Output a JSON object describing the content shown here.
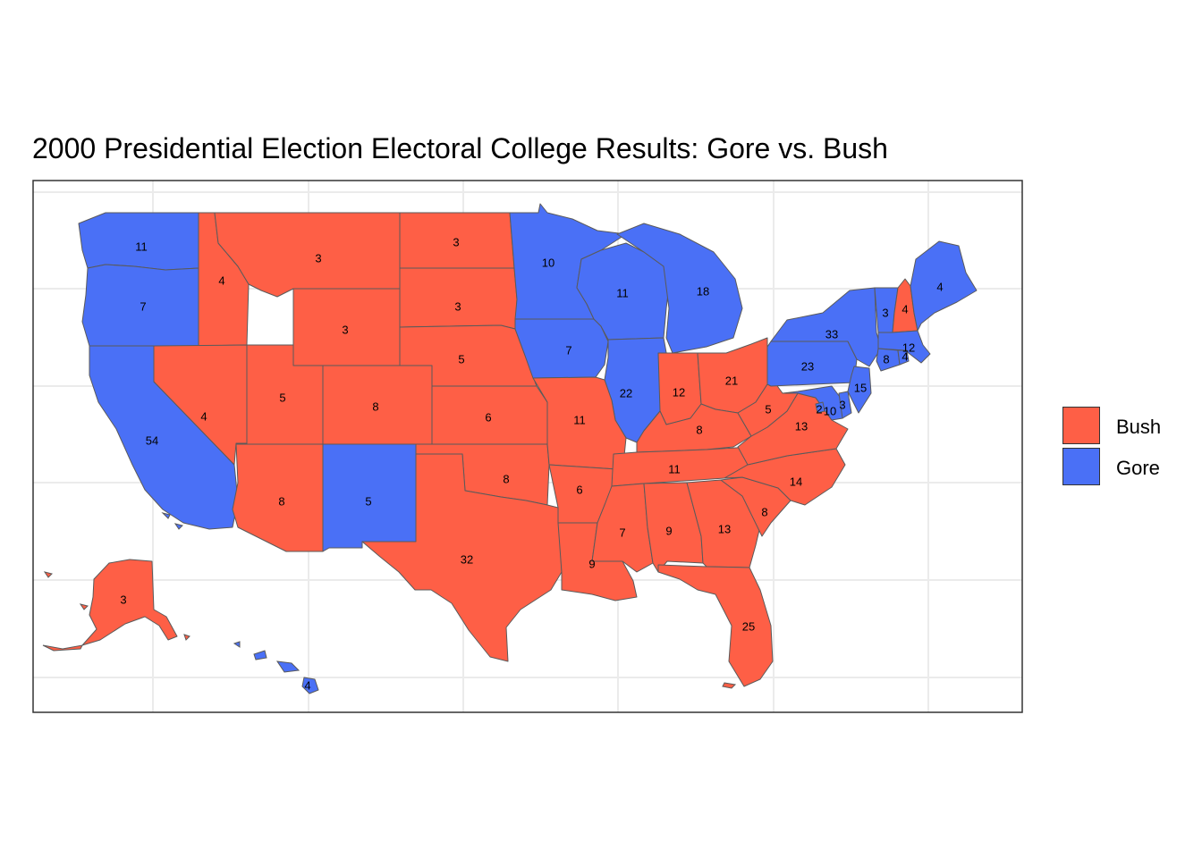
{
  "title": "2000 Presidential Election Electoral College Results: Gore vs. Bush",
  "colors": {
    "Bush": "#fe5f46",
    "Gore": "#4a70f6",
    "border": "#5a5a5a",
    "grid": "#ebebeb",
    "panel_border": "#333333"
  },
  "legend": {
    "items": [
      {
        "label": "Bush",
        "color": "#fe5f46"
      },
      {
        "label": "Gore",
        "color": "#4a70f6"
      }
    ]
  },
  "chart_data": {
    "type": "choropleth",
    "title": "2000 Presidential Election Electoral College Results: Gore vs. Bush",
    "legend_position": "right",
    "categories": [
      "Bush",
      "Gore"
    ],
    "states": [
      {
        "state": "WA",
        "votes": 11,
        "winner": "Gore"
      },
      {
        "state": "OR",
        "votes": 7,
        "winner": "Gore"
      },
      {
        "state": "CA",
        "votes": 54,
        "winner": "Gore"
      },
      {
        "state": "ID",
        "votes": 4,
        "winner": "Bush"
      },
      {
        "state": "NV",
        "votes": 4,
        "winner": "Bush"
      },
      {
        "state": "MT",
        "votes": 3,
        "winner": "Bush"
      },
      {
        "state": "WY",
        "votes": 3,
        "winner": "Bush"
      },
      {
        "state": "UT",
        "votes": 5,
        "winner": "Bush"
      },
      {
        "state": "AZ",
        "votes": 8,
        "winner": "Bush"
      },
      {
        "state": "CO",
        "votes": 8,
        "winner": "Bush"
      },
      {
        "state": "NM",
        "votes": 5,
        "winner": "Gore"
      },
      {
        "state": "ND",
        "votes": 3,
        "winner": "Bush"
      },
      {
        "state": "SD",
        "votes": 3,
        "winner": "Bush"
      },
      {
        "state": "NE",
        "votes": 5,
        "winner": "Bush"
      },
      {
        "state": "KS",
        "votes": 6,
        "winner": "Bush"
      },
      {
        "state": "OK",
        "votes": 8,
        "winner": "Bush"
      },
      {
        "state": "TX",
        "votes": 32,
        "winner": "Bush"
      },
      {
        "state": "MN",
        "votes": 10,
        "winner": "Gore"
      },
      {
        "state": "IA",
        "votes": 7,
        "winner": "Gore"
      },
      {
        "state": "MO",
        "votes": 11,
        "winner": "Bush"
      },
      {
        "state": "AR",
        "votes": 6,
        "winner": "Bush"
      },
      {
        "state": "LA",
        "votes": 9,
        "winner": "Bush"
      },
      {
        "state": "WI",
        "votes": 11,
        "winner": "Gore"
      },
      {
        "state": "IL",
        "votes": 22,
        "winner": "Gore"
      },
      {
        "state": "MI",
        "votes": 18,
        "winner": "Gore"
      },
      {
        "state": "IN",
        "votes": 12,
        "winner": "Bush"
      },
      {
        "state": "OH",
        "votes": 21,
        "winner": "Bush"
      },
      {
        "state": "KY",
        "votes": 8,
        "winner": "Bush"
      },
      {
        "state": "TN",
        "votes": 11,
        "winner": "Bush"
      },
      {
        "state": "MS",
        "votes": 7,
        "winner": "Bush"
      },
      {
        "state": "AL",
        "votes": 9,
        "winner": "Bush"
      },
      {
        "state": "GA",
        "votes": 13,
        "winner": "Bush"
      },
      {
        "state": "FL",
        "votes": 25,
        "winner": "Bush"
      },
      {
        "state": "SC",
        "votes": 8,
        "winner": "Bush"
      },
      {
        "state": "NC",
        "votes": 14,
        "winner": "Bush"
      },
      {
        "state": "VA",
        "votes": 13,
        "winner": "Bush"
      },
      {
        "state": "WV",
        "votes": 5,
        "winner": "Bush"
      },
      {
        "state": "PA",
        "votes": 23,
        "winner": "Gore"
      },
      {
        "state": "NY",
        "votes": 33,
        "winner": "Gore"
      },
      {
        "state": "VT",
        "votes": 3,
        "winner": "Gore"
      },
      {
        "state": "NH",
        "votes": 4,
        "winner": "Bush"
      },
      {
        "state": "ME",
        "votes": 4,
        "winner": "Gore"
      },
      {
        "state": "MA",
        "votes": 12,
        "winner": "Gore"
      },
      {
        "state": "RI",
        "votes": 4,
        "winner": "Gore"
      },
      {
        "state": "CT",
        "votes": 8,
        "winner": "Gore"
      },
      {
        "state": "NJ",
        "votes": 15,
        "winner": "Gore"
      },
      {
        "state": "DE",
        "votes": 3,
        "winner": "Gore"
      },
      {
        "state": "MD",
        "votes": 10,
        "winner": "Gore"
      },
      {
        "state": "DC",
        "votes": 2,
        "winner": "Gore"
      },
      {
        "state": "AK",
        "votes": 3,
        "winner": "Bush"
      },
      {
        "state": "HI",
        "votes": 4,
        "winner": "Gore"
      }
    ]
  }
}
